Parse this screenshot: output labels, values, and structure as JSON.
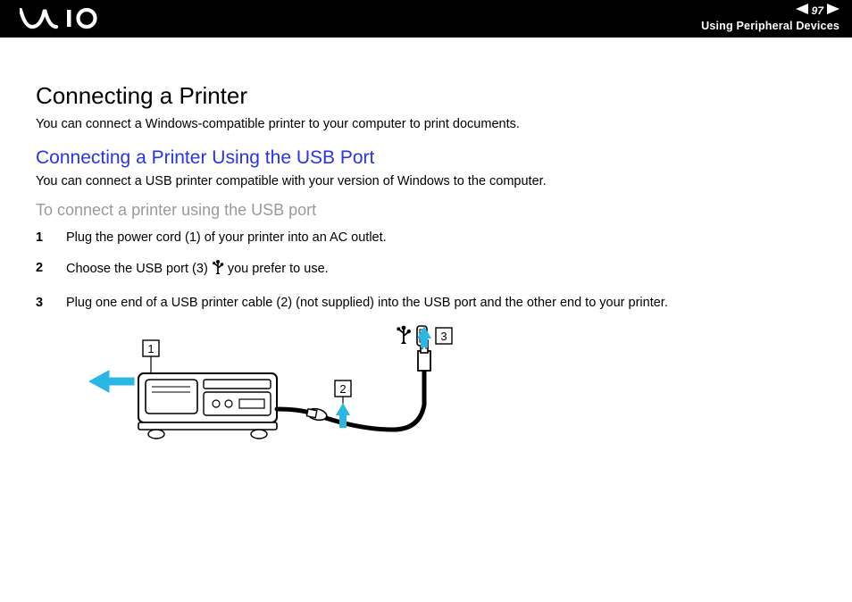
{
  "header": {
    "page_number": "97",
    "section_label": "Using Peripheral Devices"
  },
  "content": {
    "heading": "Connecting a Printer",
    "intro": "You can connect a Windows-compatible printer to your computer to print documents.",
    "sub_heading": "Connecting a Printer Using the USB Port",
    "sub_intro": "You can connect a USB printer compatible with your version of Windows to the computer.",
    "proc_heading": "To connect a printer using the USB port",
    "steps": {
      "s1": "Plug the power cord (1) of your printer into an AC outlet.",
      "s2_pre": "Choose the USB port (3) ",
      "s2_post": " you prefer to use.",
      "s3": "Plug one end of a USB printer cable (2) (not supplied) into the USB port and the other end to your printer."
    }
  },
  "diagram": {
    "callouts": {
      "c1": "1",
      "c2": "2",
      "c3": "3"
    }
  }
}
